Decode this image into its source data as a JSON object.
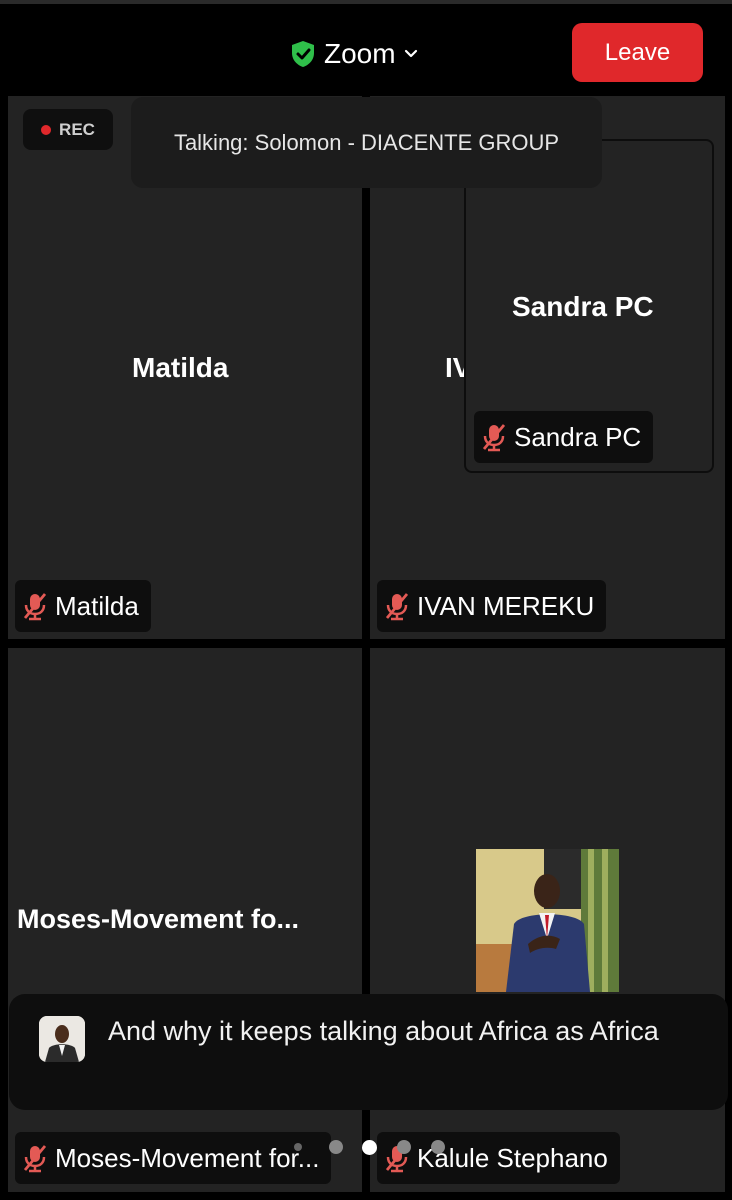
{
  "header": {
    "app_title": "Zoom",
    "leave_label": "Leave",
    "colors": {
      "leave": "#e0282b",
      "shield": "#2fbf4a"
    }
  },
  "recording": {
    "label": "REC"
  },
  "talking_banner": {
    "text": "Talking: Solomon - DIACENTE GROUP"
  },
  "participants": [
    {
      "center_name": "Matilda",
      "label": "Matilda",
      "muted": true
    },
    {
      "center_name": "IV",
      "label": "IVAN MEREKU",
      "muted": true
    },
    {
      "center_name": "Moses-Movement fo...",
      "label": "Moses-Movement for...",
      "muted": true
    },
    {
      "center_name": "",
      "label": "Kalule Stephano",
      "muted": true,
      "has_video_photo": true
    }
  ],
  "floating_thumbnail": {
    "center_name": "Sandra PC",
    "label": "Sandra PC",
    "muted": true
  },
  "caption": {
    "text": "And why it keeps talking about Africa as Africa"
  },
  "pagination": {
    "pages": 4,
    "current": 2
  },
  "icons": [
    "shield-check-icon",
    "chevron-down-icon",
    "muted-mic-icon",
    "record-dot-icon"
  ]
}
